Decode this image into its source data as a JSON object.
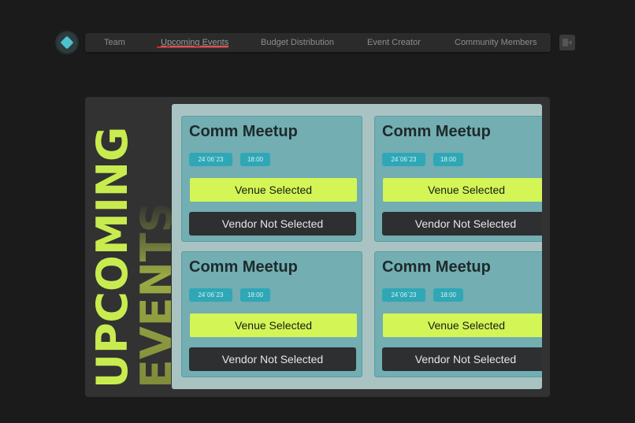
{
  "nav": {
    "items": [
      {
        "label": "Team"
      },
      {
        "label": "Upcoming Events"
      },
      {
        "label": "Budget Distribution"
      },
      {
        "label": "Event Creator"
      },
      {
        "label": "Community Members"
      }
    ],
    "active_index": 1
  },
  "page": {
    "title_line1": "UPCOMING",
    "title_line2": "EVENTS"
  },
  "events": [
    {
      "title": "Comm Meetup",
      "date": "24`06`23",
      "time": "18:00",
      "venue_status": "Venue Selected",
      "vendor_status": "Vendor Not Selected"
    },
    {
      "title": "Comm Meetup",
      "date": "24`06`23",
      "time": "18:00",
      "venue_status": "Venue Selected",
      "vendor_status": "Vendor Not Selected"
    },
    {
      "title": "Comm Meetup",
      "date": "24`06`23",
      "time": "18:00",
      "venue_status": "Venue Selected",
      "vendor_status": "Vendor Not Selected"
    },
    {
      "title": "Comm Meetup",
      "date": "24`06`23",
      "time": "18:00",
      "venue_status": "Venue Selected",
      "vendor_status": "Vendor Not Selected"
    }
  ],
  "icons": {
    "logo": "diamond-logo-icon",
    "logout": "logout-icon"
  },
  "colors": {
    "background": "#1b1b1b",
    "accent_green": "#d3f556",
    "title_green": "#c8ec4f",
    "chip_teal": "#2fa7b6",
    "card_teal": "#72aeb2",
    "active_underline": "#d62b2b"
  }
}
